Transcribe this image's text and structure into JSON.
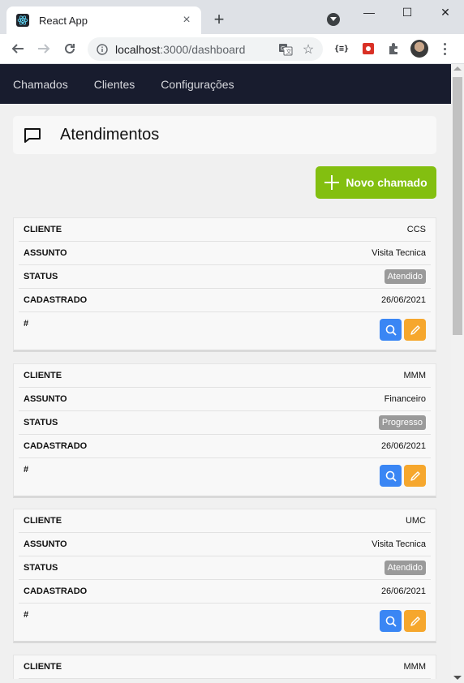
{
  "browser": {
    "tab_title": "React App",
    "tab_close": "×",
    "new_tab": "+",
    "url_host": "localhost",
    "url_rest": ":3000/dashboard",
    "ext_json": "{≡}",
    "window_min": "—",
    "window_max": "☐",
    "window_close": "✕"
  },
  "nav": {
    "items": [
      "Chamados",
      "Clientes",
      "Configurações"
    ]
  },
  "header": {
    "title": "Atendimentos"
  },
  "new_button": {
    "label": "Novo chamado",
    "color": "#83bf10"
  },
  "colors": {
    "view": "#3a86f4",
    "edit": "#f6a72d",
    "nav_bg": "#181c2e"
  },
  "labels": {
    "cliente": "CLIENTE",
    "assunto": "ASSUNTO",
    "status": "STATUS",
    "cadastrado": "CADASTRADO",
    "hash": "#"
  },
  "tickets": [
    {
      "cliente": "CCS",
      "assunto": "Visita Tecnica",
      "status": "Atendido",
      "cadastrado": "26/06/2021"
    },
    {
      "cliente": "MMM",
      "assunto": "Financeiro",
      "status": "Progresso",
      "cadastrado": "26/06/2021"
    },
    {
      "cliente": "UMC",
      "assunto": "Visita Tecnica",
      "status": "Atendido",
      "cadastrado": "26/06/2021"
    },
    {
      "cliente": "MMM"
    }
  ]
}
